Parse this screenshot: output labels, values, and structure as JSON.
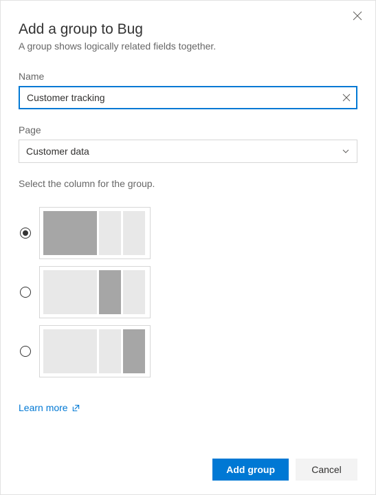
{
  "dialog": {
    "title": "Add a group to Bug",
    "subtitle": "A group shows logically related fields together."
  },
  "name_field": {
    "label": "Name",
    "value": "Customer tracking"
  },
  "page_field": {
    "label": "Page",
    "value": "Customer data"
  },
  "column_section": {
    "prompt": "Select the column for the group.",
    "selected_index": 0
  },
  "learn_more": {
    "label": "Learn more"
  },
  "footer": {
    "primary": "Add group",
    "secondary": "Cancel"
  }
}
